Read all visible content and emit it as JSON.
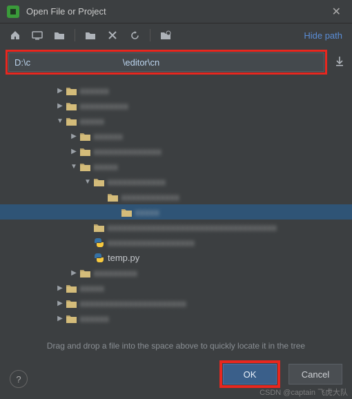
{
  "titlebar": {
    "title": "Open File or Project"
  },
  "toolbar": {
    "hide_path": "Hide path",
    "icons": [
      "home",
      "desktop",
      "project",
      "newfolder",
      "delete",
      "refresh",
      "showhidden"
    ]
  },
  "path": {
    "value": "D:\\c                                     \\editor\\cn"
  },
  "tree": [
    {
      "indent": 80,
      "arrow": "▶",
      "type": "folder",
      "label": "xxxxxx",
      "blur": true
    },
    {
      "indent": 80,
      "arrow": "▶",
      "type": "folder",
      "label": "xxxxxxxxxx",
      "blur": true
    },
    {
      "indent": 80,
      "arrow": "▼",
      "type": "folder",
      "label": "xxxxx",
      "blur": true
    },
    {
      "indent": 100,
      "arrow": "▶",
      "type": "folder",
      "label": "xxxxxx",
      "blur": true
    },
    {
      "indent": 100,
      "arrow": "▶",
      "type": "folder",
      "label": "xxxxxxxxxxxxxx",
      "blur": true
    },
    {
      "indent": 100,
      "arrow": "▼",
      "type": "folder",
      "label": "xxxxx",
      "blur": true
    },
    {
      "indent": 120,
      "arrow": "▼",
      "type": "folder",
      "label": "xxxxxxxxxxxx",
      "blur": true
    },
    {
      "indent": 140,
      "arrow": "",
      "type": "folder",
      "label": "xxxxxxxxxxxx",
      "blur": true
    },
    {
      "indent": 160,
      "arrow": "",
      "type": "folder",
      "label": "xxxxx",
      "blur": true,
      "selected": true
    },
    {
      "indent": 120,
      "arrow": "",
      "type": "folder",
      "label": "xxxxxxxxxxxxxxxxxxxxxxxxxxxxxxxxxxx",
      "blur": true
    },
    {
      "indent": 120,
      "arrow": "",
      "type": "py",
      "label": "xxxxxxxxxxxxxxxxxx",
      "blur": true
    },
    {
      "indent": 120,
      "arrow": "",
      "type": "py",
      "label": "temp.py",
      "blur": false
    },
    {
      "indent": 100,
      "arrow": "▶",
      "type": "folder",
      "label": "xxxxxxxxx",
      "blur": true
    },
    {
      "indent": 80,
      "arrow": "▶",
      "type": "folder",
      "label": "xxxxx",
      "blur": true
    },
    {
      "indent": 80,
      "arrow": "▶",
      "type": "folder",
      "label": "xxxxxxxxxxxxxxxxxxxxxx",
      "blur": true
    },
    {
      "indent": 80,
      "arrow": "▶",
      "type": "folder",
      "label": "xxxxxx",
      "blur": true
    }
  ],
  "hint": "Drag and drop a file into the space above to quickly locate it in the tree",
  "buttons": {
    "ok": "OK",
    "cancel": "Cancel",
    "help": "?"
  },
  "watermark": "CSDN @captain 飞虎大队",
  "colors": {
    "highlight_border": "#e8271f",
    "selection": "#2f5476",
    "link": "#5a8dd6"
  }
}
